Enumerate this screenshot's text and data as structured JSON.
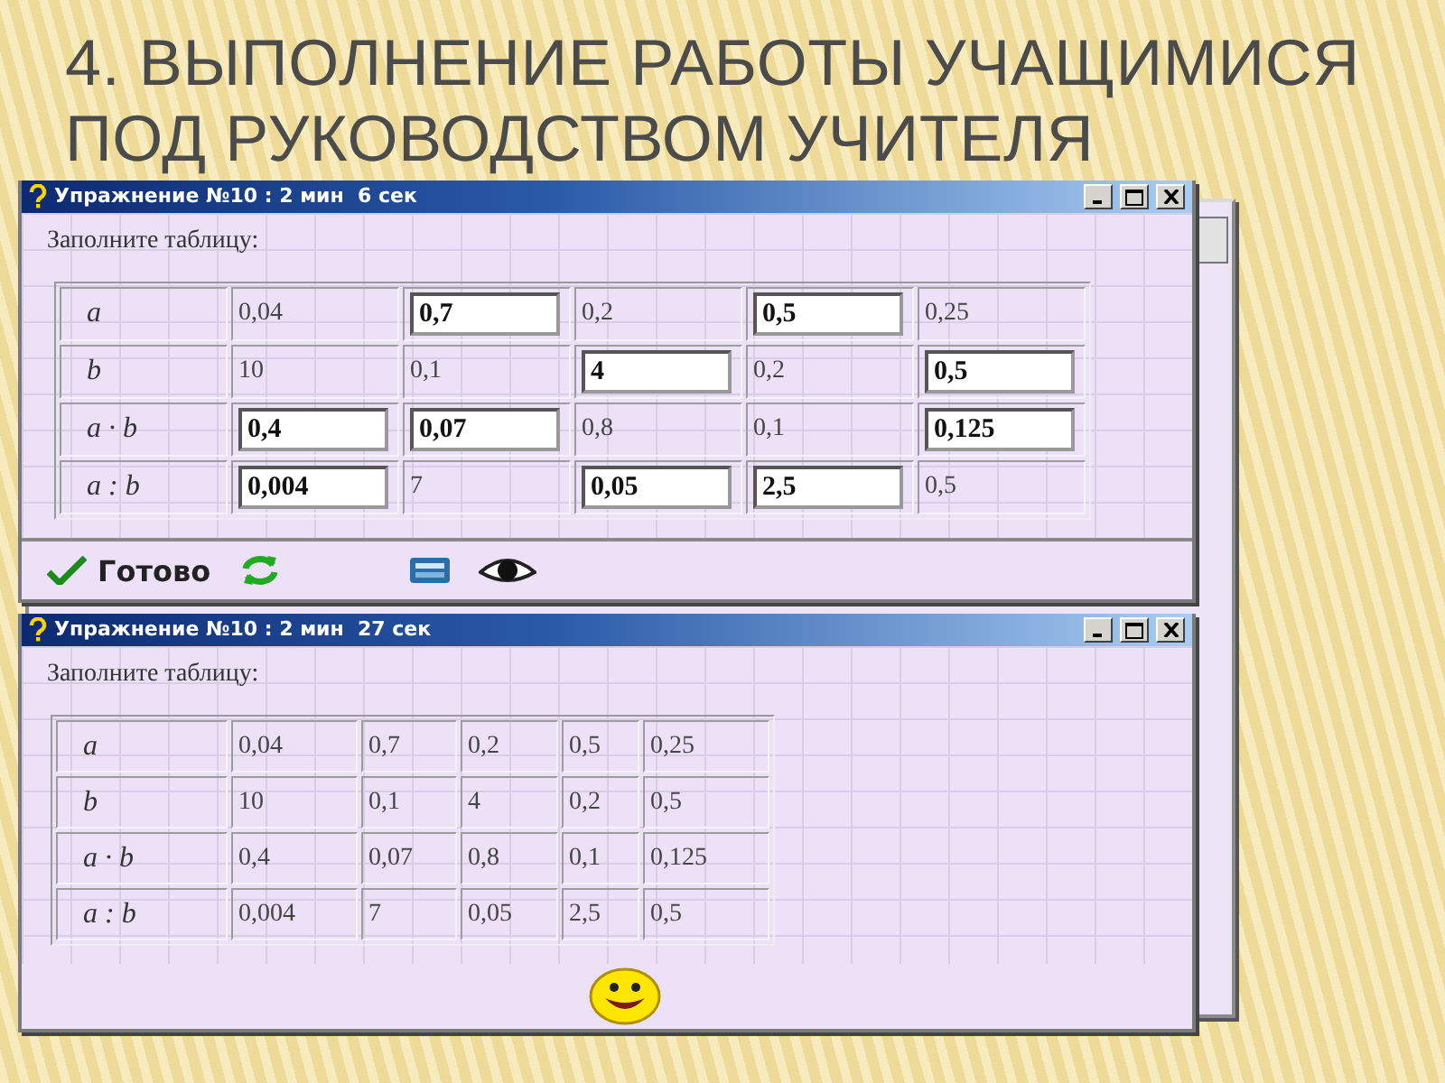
{
  "heading": "4. ВЫПОЛНЕНИЕ РАБОТЫ УЧАЩИМИСЯ ПОД РУКОВОДСТВОМ УЧИТЕЛЯ",
  "windows": [
    {
      "title": "Упражнение №10 : 2 мин  6 сек",
      "prompt": "Заполните таблицу:",
      "kind": "exercise",
      "done_label": "Готово",
      "rows": [
        {
          "label": "a",
          "cells": [
            {
              "text": "0,04",
              "kind": "given"
            },
            {
              "text": "0,7",
              "kind": "input"
            },
            {
              "text": "0,2",
              "kind": "given"
            },
            {
              "text": "0,5",
              "kind": "input"
            },
            {
              "text": "0,25",
              "kind": "given"
            }
          ]
        },
        {
          "label": "b",
          "cells": [
            {
              "text": "10",
              "kind": "given"
            },
            {
              "text": "0,1",
              "kind": "given"
            },
            {
              "text": "4",
              "kind": "input"
            },
            {
              "text": "0,2",
              "kind": "given"
            },
            {
              "text": "0,5",
              "kind": "input"
            }
          ]
        },
        {
          "label": "a · b",
          "cells": [
            {
              "text": "0,4",
              "kind": "input"
            },
            {
              "text": "0,07",
              "kind": "input"
            },
            {
              "text": "0,8",
              "kind": "given"
            },
            {
              "text": "0,1",
              "kind": "given"
            },
            {
              "text": "0,125",
              "kind": "input"
            }
          ]
        },
        {
          "label": "a : b",
          "cells": [
            {
              "text": "0,004",
              "kind": "input"
            },
            {
              "text": "7",
              "kind": "given"
            },
            {
              "text": "0,05",
              "kind": "input"
            },
            {
              "text": "2,5",
              "kind": "input"
            },
            {
              "text": "0,5",
              "kind": "given"
            }
          ]
        }
      ]
    },
    {
      "title": "Упражнение №10 : 2 мин  27 сек",
      "prompt": "Заполните таблицу:",
      "kind": "result",
      "rows": [
        {
          "label": "a",
          "cells": [
            {
              "text": "0,04",
              "kind": "given"
            },
            {
              "text": "0,7",
              "kind": "given"
            },
            {
              "text": "0,2",
              "kind": "given"
            },
            {
              "text": "0,5",
              "kind": "given"
            },
            {
              "text": "0,25",
              "kind": "given"
            }
          ]
        },
        {
          "label": "b",
          "cells": [
            {
              "text": "10",
              "kind": "given"
            },
            {
              "text": "0,1",
              "kind": "given"
            },
            {
              "text": "4",
              "kind": "given"
            },
            {
              "text": "0,2",
              "kind": "given"
            },
            {
              "text": "0,5",
              "kind": "given"
            }
          ]
        },
        {
          "label": "a · b",
          "cells": [
            {
              "text": "0,4",
              "kind": "given"
            },
            {
              "text": "0,07",
              "kind": "given"
            },
            {
              "text": "0,8",
              "kind": "given"
            },
            {
              "text": "0,1",
              "kind": "given"
            },
            {
              "text": "0,125",
              "kind": "given"
            }
          ]
        },
        {
          "label": "a : b",
          "cells": [
            {
              "text": "0,004",
              "kind": "given"
            },
            {
              "text": "7",
              "kind": "given"
            },
            {
              "text": "0,05",
              "kind": "given"
            },
            {
              "text": "2,5",
              "kind": "given"
            },
            {
              "text": "0,5",
              "kind": "given"
            }
          ]
        }
      ]
    }
  ]
}
